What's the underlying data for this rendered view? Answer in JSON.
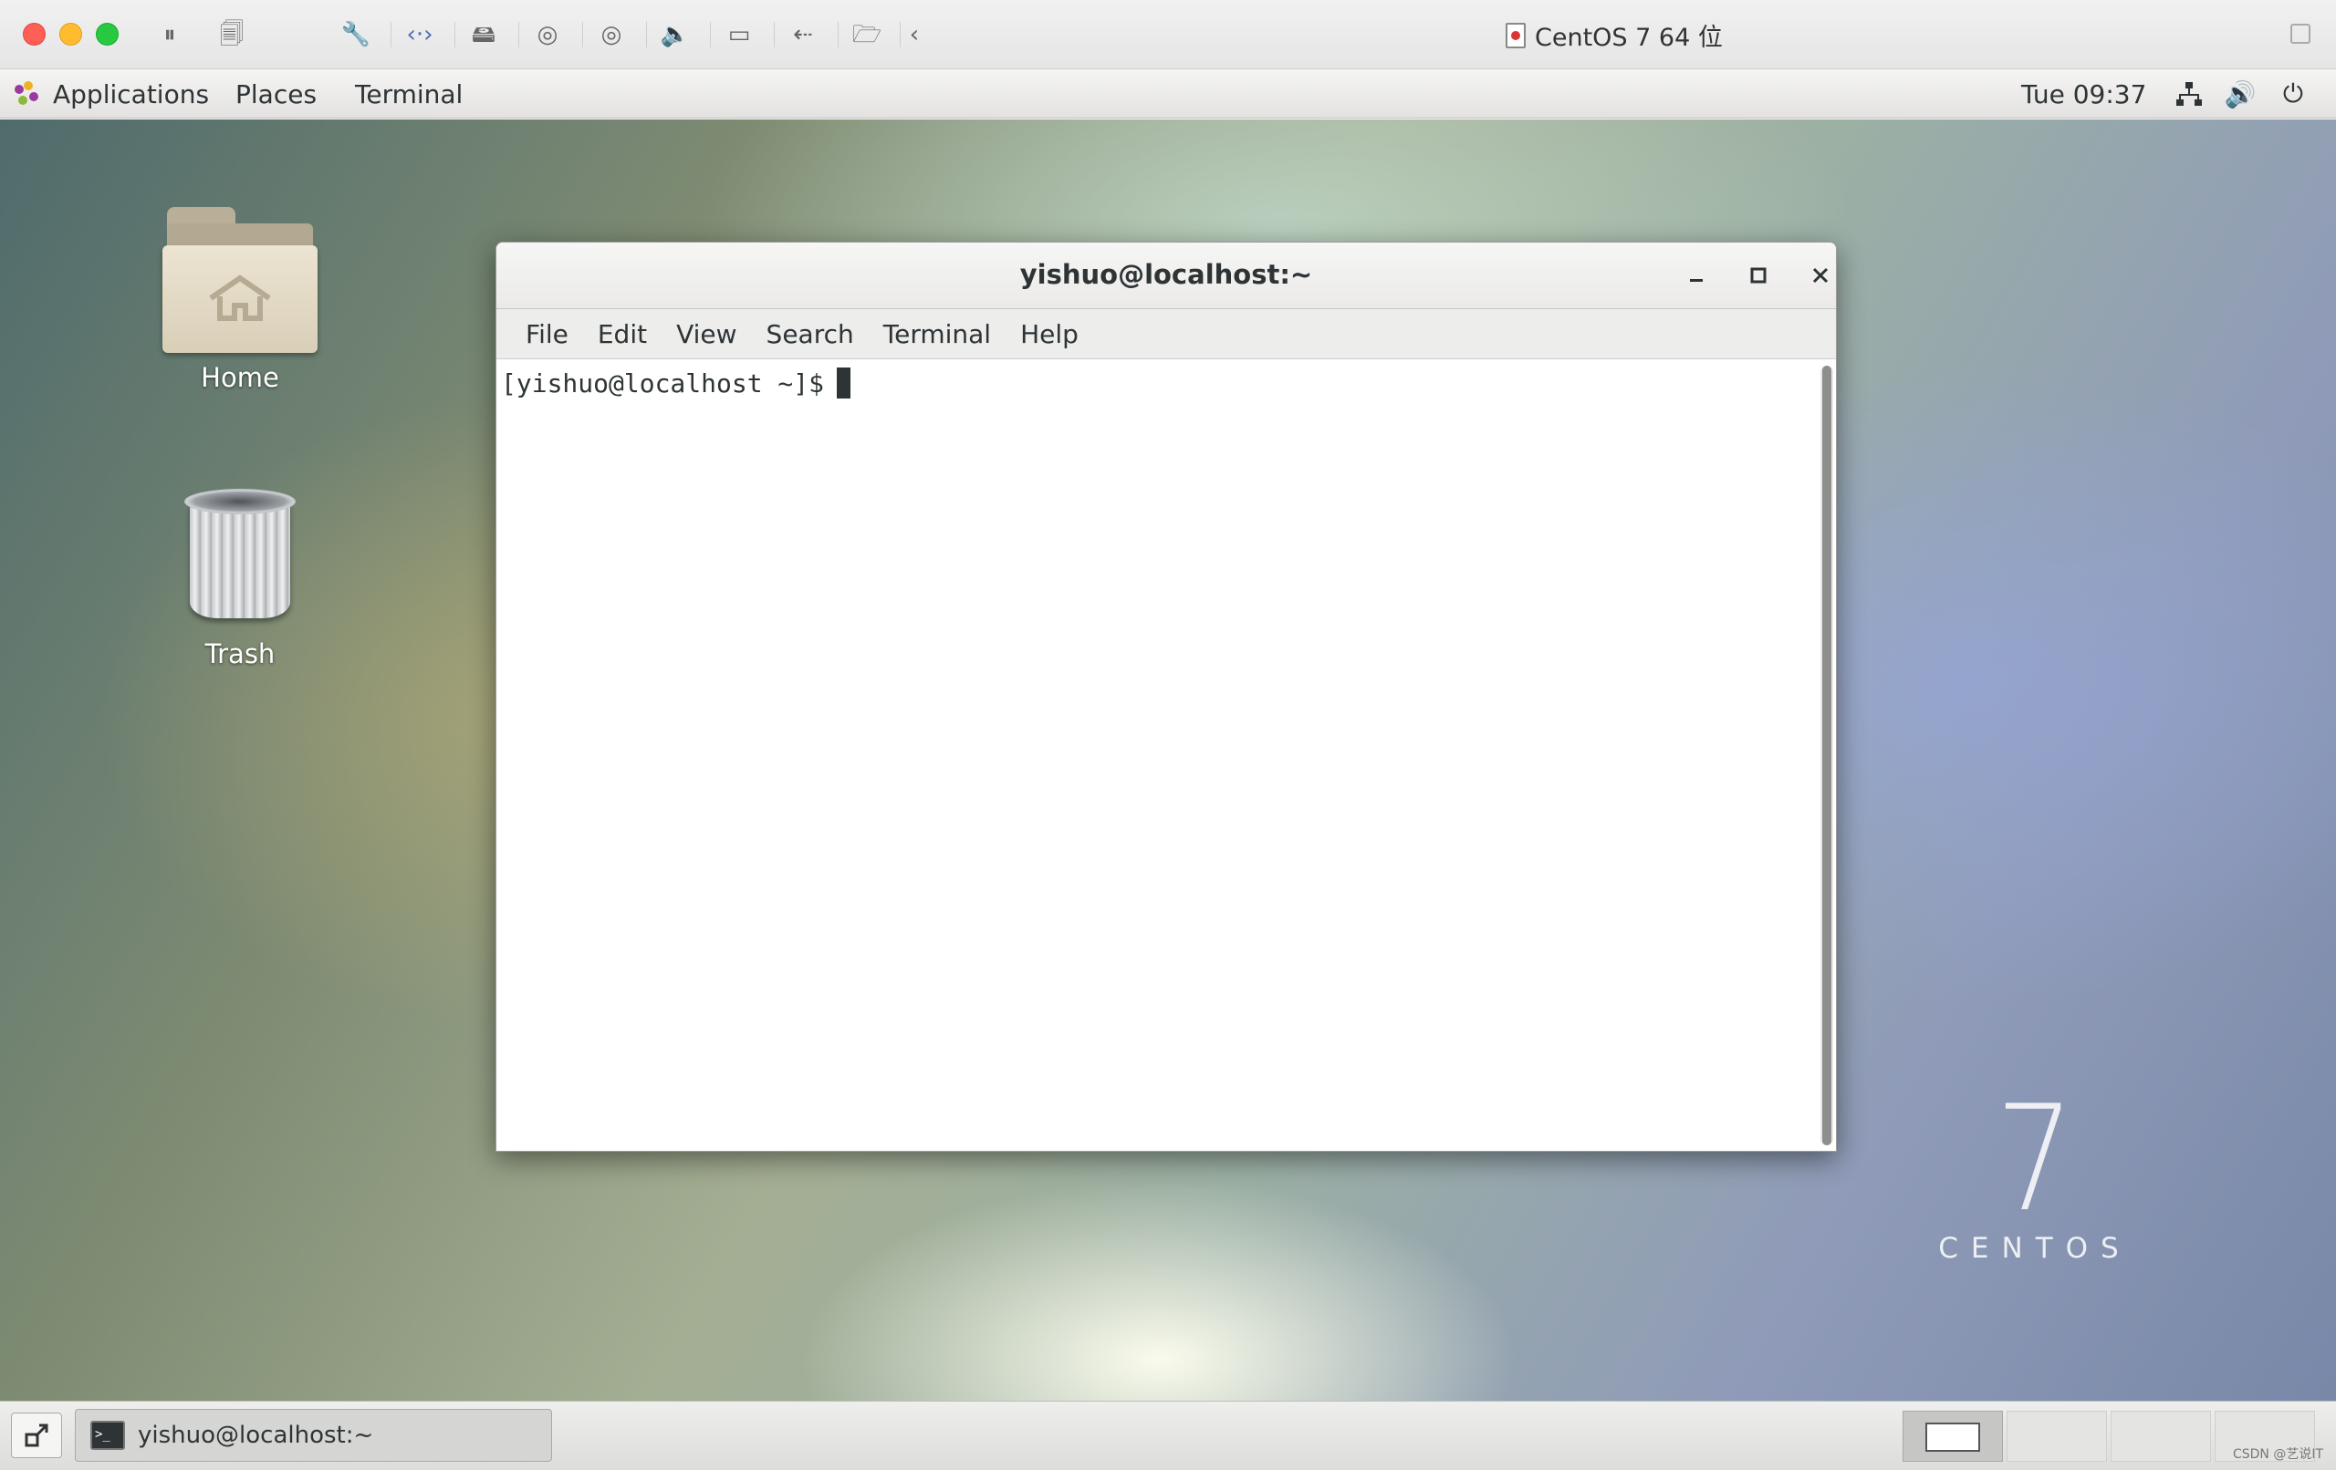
{
  "vm_window": {
    "title": "CentOS 7 64 位",
    "tools": [
      "pause-icon",
      "snapshot-icon",
      "settings-wrench-icon",
      "network-arrows-icon",
      "hard-disk-icon",
      "camera-icon",
      "printer-icon",
      "sound-icon",
      "video-camera-icon",
      "usb-icon",
      "shared-folder-icon",
      "collapse-chevron-icon"
    ]
  },
  "topbar": {
    "applications": "Applications",
    "places": "Places",
    "terminal": "Terminal",
    "clock": "Tue 09:37",
    "status_icons": [
      "network-icon",
      "volume-icon",
      "power-icon"
    ]
  },
  "desktop": {
    "icons": [
      {
        "label": "Home",
        "icon": "home-folder-icon"
      },
      {
        "label": "Trash",
        "icon": "trash-icon"
      }
    ],
    "brand_number": "7",
    "brand_word": "CENTOS"
  },
  "terminal_window": {
    "title": "yishuo@localhost:~",
    "menu": [
      "File",
      "Edit",
      "View",
      "Search",
      "Terminal",
      "Help"
    ],
    "prompt": "[yishuo@localhost ~]$"
  },
  "taskbar": {
    "task_label": "yishuo@localhost:~",
    "workspaces": 4,
    "active_workspace": 1,
    "watermark": "CSDN @艺说IT"
  }
}
